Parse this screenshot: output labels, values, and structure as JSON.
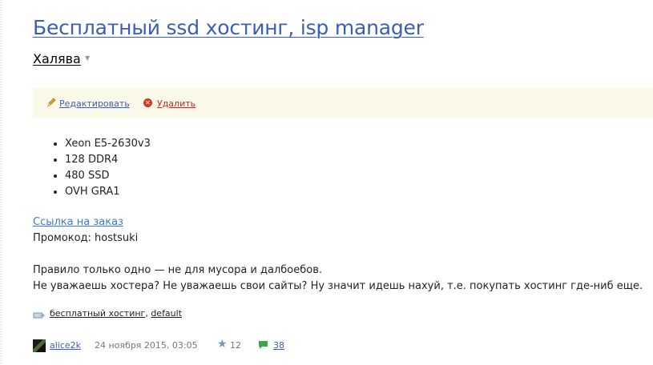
{
  "post": {
    "title": "Бесплатный ssd хостинг, isp manager",
    "blog": "Халява"
  },
  "actions": {
    "edit_label": "Редактировать",
    "delete_label": "Удалить"
  },
  "specs": [
    "Xeon E5-2630v3",
    "128 DDR4",
    "480 SSD",
    "OVH GRA1"
  ],
  "order_link": "Ссылка на заказ",
  "promo": "Промокод: hostsuki",
  "body": {
    "line1": "Правило только одно — не для мусора и далбоебов.",
    "line2": "Не уважаешь хостера? Не уважаешь свои сайты? Ну значит идешь нахуй, т.е. покупать хостинг где-ниб еще."
  },
  "tags": {
    "tag1": "бесплатный хостинг",
    "separator": ",",
    "tag2": "default"
  },
  "meta": {
    "author": "alice2k",
    "date": "24 ноября 2015, 03:05",
    "rating": "12",
    "comments": "38"
  },
  "colors": {
    "link": "#3b5eb8",
    "action_bar_bg": "#fbf9e7",
    "delete": "#c62828"
  }
}
